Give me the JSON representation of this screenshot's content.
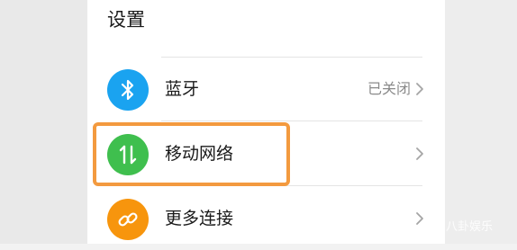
{
  "page": {
    "title": "设置"
  },
  "rows": [
    {
      "label": "蓝牙",
      "status": "已关闭",
      "icon": "bluetooth-icon",
      "icon_color": "#1aa3f0"
    },
    {
      "label": "移动网络",
      "status": "",
      "icon": "mobile-data-icon",
      "icon_color": "#3fbf4e"
    },
    {
      "label": "更多连接",
      "status": "",
      "icon": "link-icon",
      "icon_color": "#f7950d"
    }
  ],
  "highlight": {
    "color": "#f39a3f"
  },
  "watermark": {
    "text": "八卦娱乐"
  }
}
